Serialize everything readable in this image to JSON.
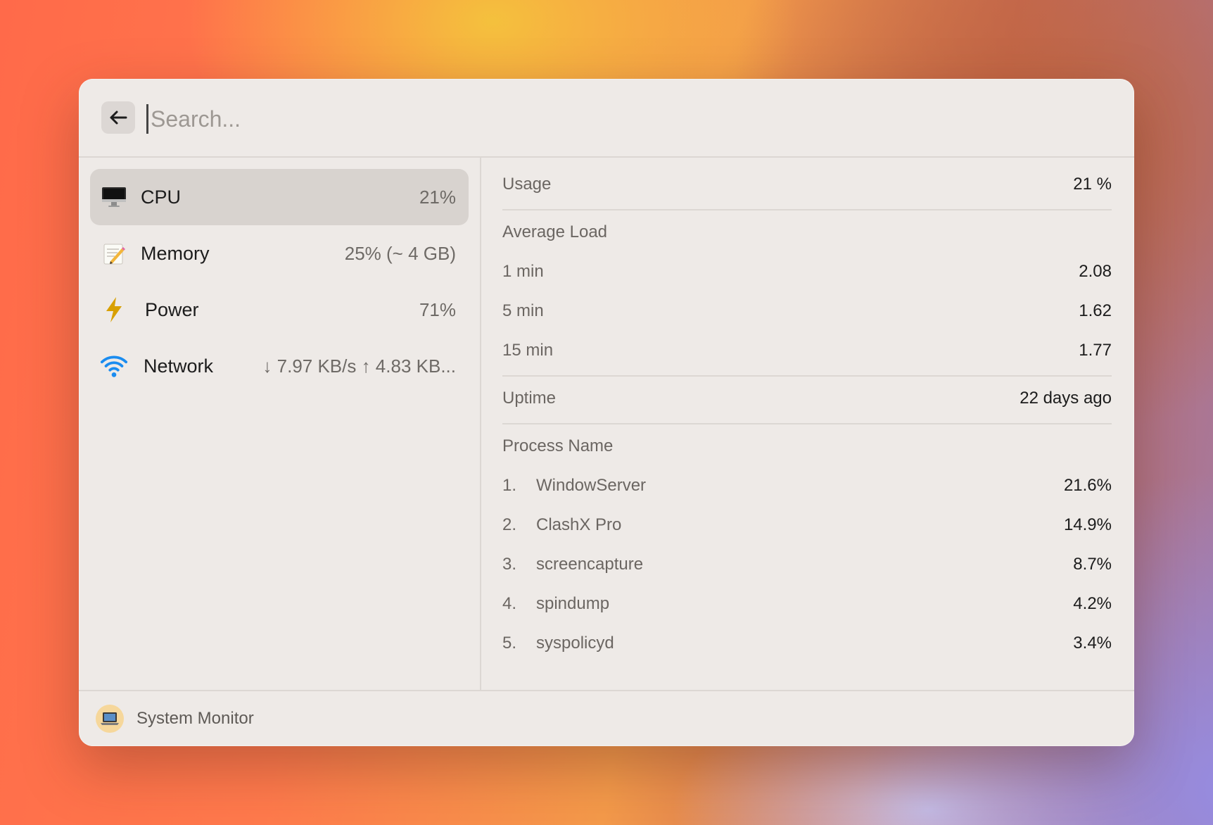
{
  "search": {
    "placeholder": "Search..."
  },
  "sidebar": {
    "items": [
      {
        "label": "CPU",
        "value": "21%",
        "icon": "monitor-icon",
        "selected": true
      },
      {
        "label": "Memory",
        "value": "25% (~ 4 GB)",
        "icon": "memo-icon",
        "selected": false
      },
      {
        "label": "Power",
        "value": "71%",
        "icon": "lightning-icon",
        "selected": false
      },
      {
        "label": "Network",
        "value": "↓ 7.97 KB/s ↑ 4.83 KB...",
        "icon": "wifi-icon",
        "selected": false
      }
    ]
  },
  "detail": {
    "usage": {
      "label": "Usage",
      "value": "21 %"
    },
    "average_load": {
      "title": "Average Load",
      "rows": [
        {
          "label": "1 min",
          "value": "2.08"
        },
        {
          "label": "5 min",
          "value": "1.62"
        },
        {
          "label": "15 min",
          "value": "1.77"
        }
      ]
    },
    "uptime": {
      "label": "Uptime",
      "value": "22 days ago"
    },
    "processes": {
      "title": "Process Name",
      "rows": [
        {
          "index": "1.",
          "name": "WindowServer",
          "value": "21.6%"
        },
        {
          "index": "2.",
          "name": "ClashX Pro",
          "value": "14.9%"
        },
        {
          "index": "3.",
          "name": "screencapture",
          "value": "8.7%"
        },
        {
          "index": "4.",
          "name": "spindump",
          "value": "4.2%"
        },
        {
          "index": "5.",
          "name": "syspolicyd",
          "value": "3.4%"
        }
      ]
    }
  },
  "footer": {
    "label": "System Monitor",
    "icon": "laptop-icon"
  },
  "colors": {
    "wifi": "#1a8cf0",
    "lightning": "#d8a000",
    "selected_bg": "#d8d3cf"
  }
}
